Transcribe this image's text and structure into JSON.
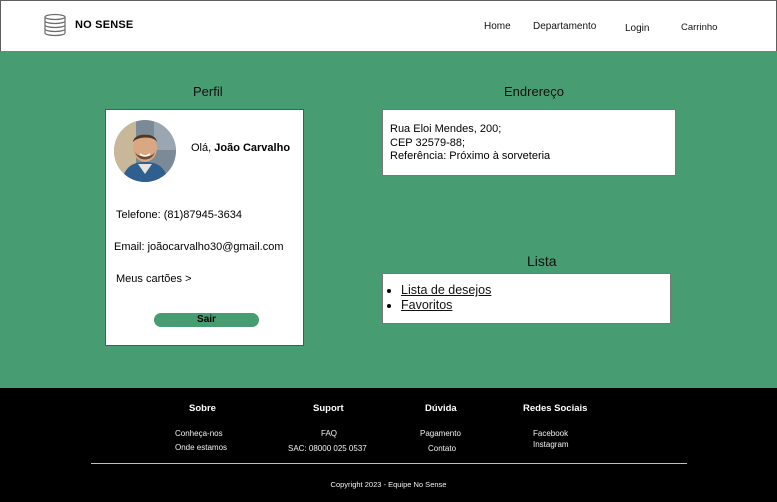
{
  "header": {
    "brand": "NO SENSE",
    "logo_icon": "stack-icon",
    "nav": [
      "Home",
      "Departamento",
      "Login",
      "Carrinho"
    ]
  },
  "profile": {
    "title": "Perfil",
    "greeting_prefix": "Olá, ",
    "user_name": "João Carvalho",
    "phone": "Telefone: (81)87945-3634",
    "email": "Email: joãocarvalho30@gmail.com",
    "cards": "Meus cartões >",
    "logout_label": "Sair"
  },
  "address": {
    "title": "Endrereço",
    "lines": [
      "Rua Eloi Mendes, 200;",
      "CEP 32579-88;",
      "Referência: Próximo à sorveteria"
    ]
  },
  "list": {
    "title": "Lista",
    "items": [
      "Lista de desejos",
      "Favoritos"
    ]
  },
  "footer": {
    "columns": [
      {
        "heading": "Sobre",
        "links": [
          "Conheça-nos",
          "Onde estamos"
        ]
      },
      {
        "heading": "Suport",
        "links": [
          "FAQ",
          "SAC: 08000 025 0537"
        ]
      },
      {
        "heading": "Dúvida",
        "links": [
          "Pagamento",
          "Contato"
        ]
      },
      {
        "heading": "Redes Sociais",
        "links": [
          "Facebook",
          "Instagram"
        ]
      }
    ],
    "copyright": "Copyright 2023 - Equipe No Sense"
  },
  "colors": {
    "accent_green": "#489c71",
    "footer_bg": "#000000"
  }
}
